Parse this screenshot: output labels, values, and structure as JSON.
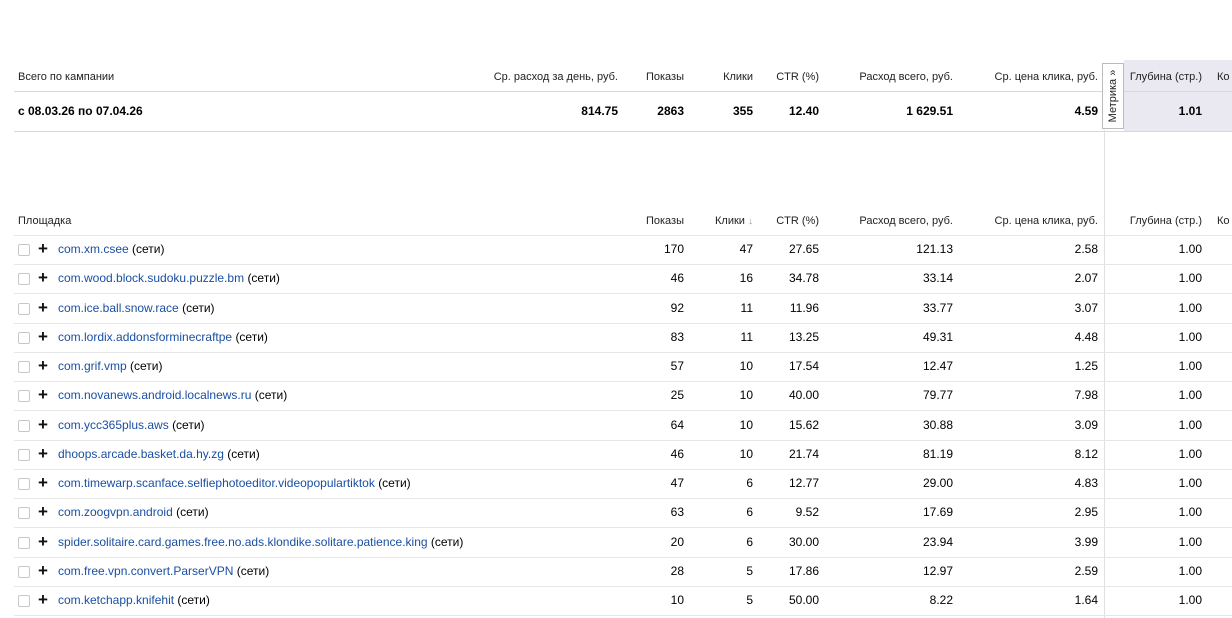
{
  "summary": {
    "headers": {
      "campaign": "Всего по кампании",
      "avg_daily": "Ср. расход за день, руб.",
      "impressions": "Показы",
      "clicks": "Клики",
      "ctr": "CTR (%)",
      "total_spend": "Расход всего, руб.",
      "avg_cpc": "Ср. цена клика, руб.",
      "depth": "Глубина (стр.)",
      "conv": "Ко"
    },
    "row": {
      "period": "с 08.03.26 по 07.04.26",
      "avg_daily": "814.75",
      "impressions": "2863",
      "clicks": "355",
      "ctr": "12.40",
      "total_spend": "1 629.51",
      "avg_cpc": "4.59",
      "depth": "1.01"
    }
  },
  "metrika_tab": {
    "label": "Метрика »"
  },
  "places": {
    "headers": {
      "place": "Площадка",
      "impressions": "Показы",
      "clicks": "Клики",
      "sort_arrow": "↓",
      "ctr": "CTR (%)",
      "total_spend": "Расход всего, руб.",
      "avg_cpc": "Ср. цена клика, руб.",
      "depth": "Глубина (стр.)",
      "conv": "Ко"
    },
    "network_suffix": "(сети)",
    "rows": [
      {
        "site": "com.xm.csee",
        "suffix": "(сети)",
        "impressions": "170",
        "clicks": "47",
        "ctr": "27.65",
        "total_spend": "121.13",
        "avg_cpc": "2.58",
        "depth": "1.00"
      },
      {
        "site": "com.wood.block.sudoku.puzzle.bm",
        "suffix": "(сети)",
        "impressions": "46",
        "clicks": "16",
        "ctr": "34.78",
        "total_spend": "33.14",
        "avg_cpc": "2.07",
        "depth": "1.00"
      },
      {
        "site": "com.ice.ball.snow.race",
        "suffix": "(сети)",
        "impressions": "92",
        "clicks": "11",
        "ctr": "11.96",
        "total_spend": "33.77",
        "avg_cpc": "3.07",
        "depth": "1.00"
      },
      {
        "site": "com.lordix.addonsforminecraftpe",
        "suffix": "(сети)",
        "impressions": "83",
        "clicks": "11",
        "ctr": "13.25",
        "total_spend": "49.31",
        "avg_cpc": "4.48",
        "depth": "1.00"
      },
      {
        "site": "com.grif.vmp",
        "suffix": "(сети)",
        "impressions": "57",
        "clicks": "10",
        "ctr": "17.54",
        "total_spend": "12.47",
        "avg_cpc": "1.25",
        "depth": "1.00"
      },
      {
        "site": "com.novanews.android.localnews.ru",
        "suffix": "(сети)",
        "impressions": "25",
        "clicks": "10",
        "ctr": "40.00",
        "total_spend": "79.77",
        "avg_cpc": "7.98",
        "depth": "1.00"
      },
      {
        "site": "com.ycc365plus.aws",
        "suffix": "(сети)",
        "impressions": "64",
        "clicks": "10",
        "ctr": "15.62",
        "total_spend": "30.88",
        "avg_cpc": "3.09",
        "depth": "1.00"
      },
      {
        "site": "dhoops.arcade.basket.da.hy.zg",
        "suffix": "(сети)",
        "impressions": "46",
        "clicks": "10",
        "ctr": "21.74",
        "total_spend": "81.19",
        "avg_cpc": "8.12",
        "depth": "1.00"
      },
      {
        "site": "com.timewarp.scanface.selfiephotoeditor.videopopulartiktok",
        "suffix": "(сети)",
        "impressions": "47",
        "clicks": "6",
        "ctr": "12.77",
        "total_spend": "29.00",
        "avg_cpc": "4.83",
        "depth": "1.00"
      },
      {
        "site": "com.zoogvpn.android",
        "suffix": "(сети)",
        "impressions": "63",
        "clicks": "6",
        "ctr": "9.52",
        "total_spend": "17.69",
        "avg_cpc": "2.95",
        "depth": "1.00"
      },
      {
        "site": "spider.solitaire.card.games.free.no.ads.klondike.solitare.patience.king",
        "suffix": "(сети)",
        "impressions": "20",
        "clicks": "6",
        "ctr": "30.00",
        "total_spend": "23.94",
        "avg_cpc": "3.99",
        "depth": "1.00"
      },
      {
        "site": "com.free.vpn.convert.ParserVPN",
        "suffix": "(сети)",
        "impressions": "28",
        "clicks": "5",
        "ctr": "17.86",
        "total_spend": "12.97",
        "avg_cpc": "2.59",
        "depth": "1.00"
      },
      {
        "site": "com.ketchapp.knifehit",
        "suffix": "(сети)",
        "impressions": "10",
        "clicks": "5",
        "ctr": "50.00",
        "total_spend": "8.22",
        "avg_cpc": "1.64",
        "depth": "1.00"
      }
    ]
  },
  "colors": {
    "link": "#1a4fa3",
    "shaded_column": "#eae8f1",
    "divider": "#d8d8d8"
  },
  "icons": {
    "expand": "plus-icon",
    "checkbox": "checkbox"
  }
}
